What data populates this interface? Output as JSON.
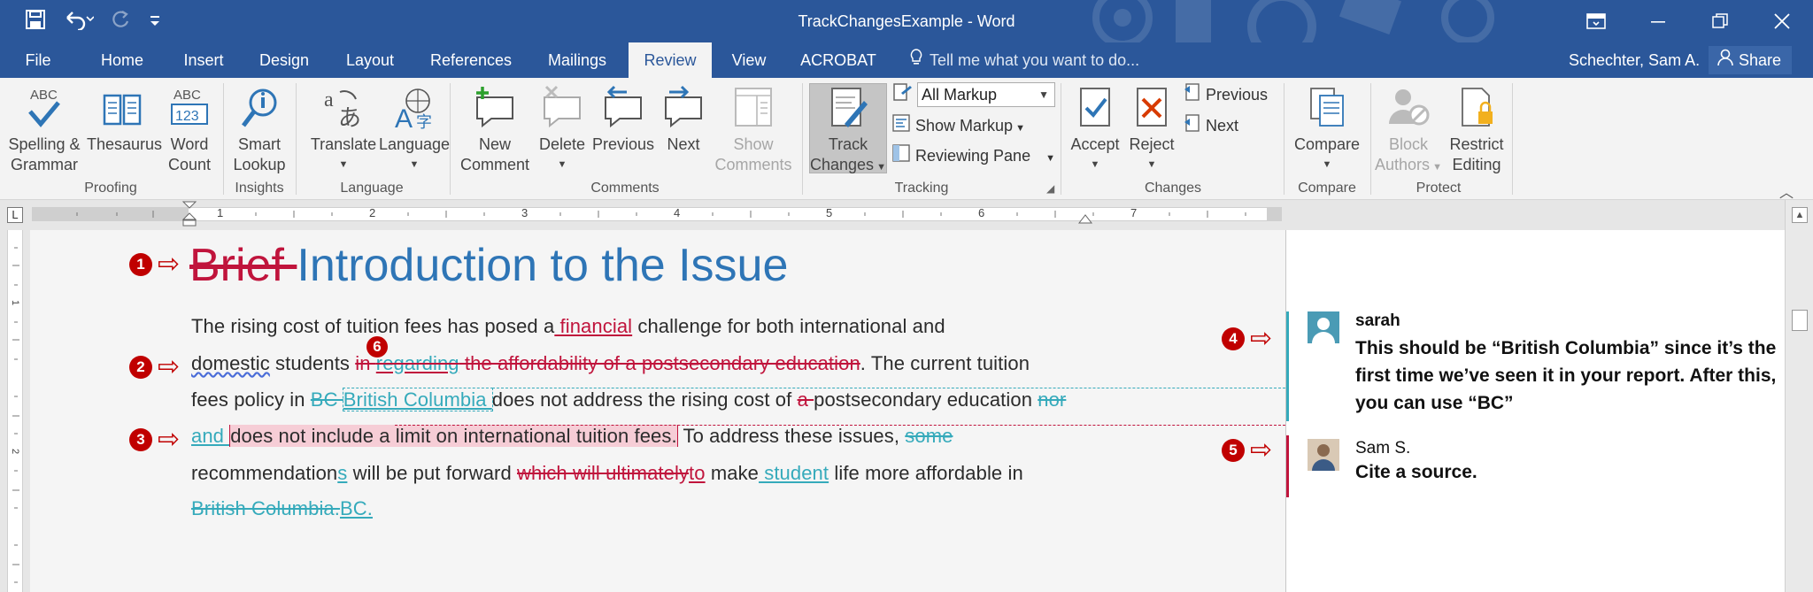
{
  "window": {
    "title": "TrackChangesExample - Word"
  },
  "tabs": [
    {
      "label": "File",
      "active": false
    },
    {
      "label": "Home",
      "active": false
    },
    {
      "label": "Insert",
      "active": false
    },
    {
      "label": "Design",
      "active": false
    },
    {
      "label": "Layout",
      "active": false
    },
    {
      "label": "References",
      "active": false
    },
    {
      "label": "Mailings",
      "active": false
    },
    {
      "label": "Review",
      "active": true
    },
    {
      "label": "View",
      "active": false
    },
    {
      "label": "ACROBAT",
      "active": false
    }
  ],
  "tell_me": {
    "placeholder": "Tell me what you want to do..."
  },
  "user": {
    "name": "Schechter, Sam A.",
    "share_label": "Share"
  },
  "ribbon": {
    "proofing": {
      "group_label": "Proofing",
      "spelling": {
        "line1": "Spelling &",
        "line2": "Grammar"
      },
      "thesaurus": {
        "line1": "Thesaurus"
      },
      "word_count": {
        "line1": "Word",
        "line2": "Count"
      }
    },
    "insights": {
      "group_label": "Insights",
      "smart_lookup": {
        "line1": "Smart",
        "line2": "Lookup"
      }
    },
    "language": {
      "group_label": "Language",
      "translate": {
        "line1": "Translate"
      },
      "language": {
        "line1": "Language"
      }
    },
    "comments": {
      "group_label": "Comments",
      "new_comment": {
        "line1": "New",
        "line2": "Comment"
      },
      "delete": {
        "line1": "Delete"
      },
      "previous": {
        "line1": "Previous"
      },
      "next": {
        "line1": "Next"
      },
      "show_comments": {
        "line1": "Show",
        "line2": "Comments"
      }
    },
    "tracking": {
      "group_label": "Tracking",
      "track_changes": {
        "line1": "Track",
        "line2": "Changes"
      },
      "markup_select": "All Markup",
      "show_markup": "Show Markup",
      "reviewing_pane": "Reviewing Pane"
    },
    "changes": {
      "group_label": "Changes",
      "accept": {
        "line1": "Accept"
      },
      "reject": {
        "line1": "Reject"
      },
      "previous": "Previous",
      "next": "Next"
    },
    "compare": {
      "group_label": "Compare",
      "compare": {
        "line1": "Compare"
      }
    },
    "protect": {
      "group_label": "Protect",
      "block_authors": {
        "line1": "Block",
        "line2": "Authors"
      },
      "restrict_editing": {
        "line1": "Restrict",
        "line2": "Editing"
      }
    }
  },
  "ruler": {
    "numbers": [
      "1",
      "2",
      "3",
      "4",
      "5",
      "6",
      "7"
    ]
  },
  "document": {
    "heading": {
      "deleted": "Brief ",
      "text": "Introduction to the Issue"
    },
    "line1": {
      "a": "The rising cost of tuition fees has posed a",
      "ins1": " financial",
      "b": " challenge for both international and"
    },
    "line2": {
      "a": "domestic",
      "b": " students ",
      "del1": "in ",
      "ins1": "regarding",
      "del2": " the affordability of a postsecondary education",
      "c": ". The current tuition"
    },
    "line3": {
      "a": "fees policy in ",
      "del1": "BC ",
      "ins1": "British Columbia ",
      "b": "does not address the rising cost of ",
      "del2": "a ",
      "c": "postsecondary education ",
      "del3": "nor "
    },
    "line4": {
      "ins1": "and ",
      "hl": "does not include a limit on international tuition fees.",
      "a": " To address these issues, ",
      "del1": "some "
    },
    "line5": {
      "a": "recommendation",
      "ins1": "s",
      "b": " will be put forward ",
      "del1": "which will ultimately",
      "ins2": "to",
      "c": " make",
      "ins3": " student",
      "d": " life more affordable in"
    },
    "line6": {
      "del1": "British Columbia.",
      "ins1": "BC."
    }
  },
  "markers": [
    "1",
    "2",
    "3",
    "4",
    "5",
    "6"
  ],
  "comments": [
    {
      "author": "sarah",
      "text": "This should be “British Columbia” since it’s the first time we’ve seen it in your report. After this, you can use “BC”",
      "color": "#35aabb"
    },
    {
      "author": "Sam S.",
      "text": "Cite a source.",
      "color": "#c0143c"
    }
  ],
  "colors": {
    "accent": "#2b579a",
    "deletion": "#c0143c",
    "revision2": "#35aabb",
    "annotation": "#c00000"
  }
}
